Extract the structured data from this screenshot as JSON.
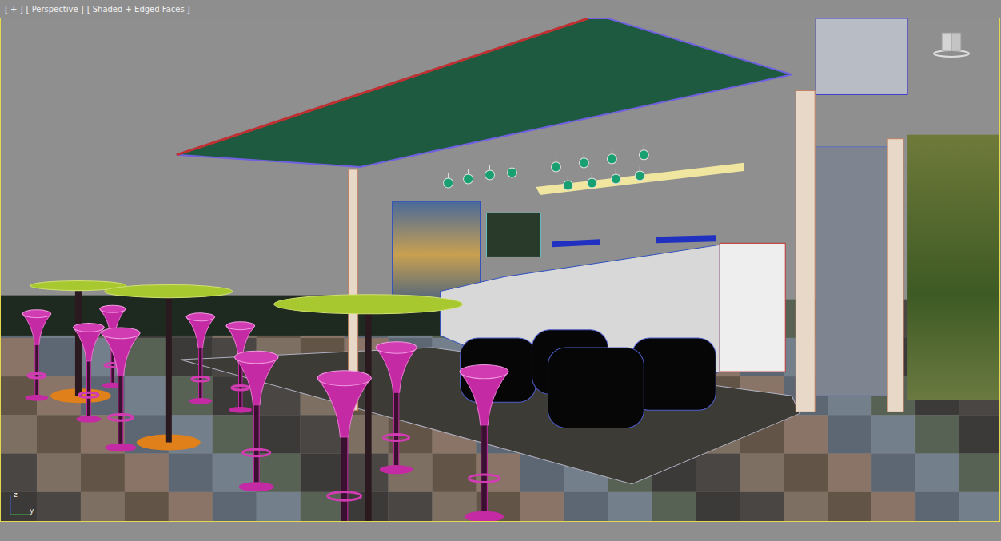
{
  "viewport": {
    "labels": [
      "[ + ]",
      "[ Perspective ]",
      "[ Shaded + Edged Faces ]"
    ],
    "active": true
  },
  "axis": {
    "labels": [
      "z",
      "y"
    ]
  }
}
